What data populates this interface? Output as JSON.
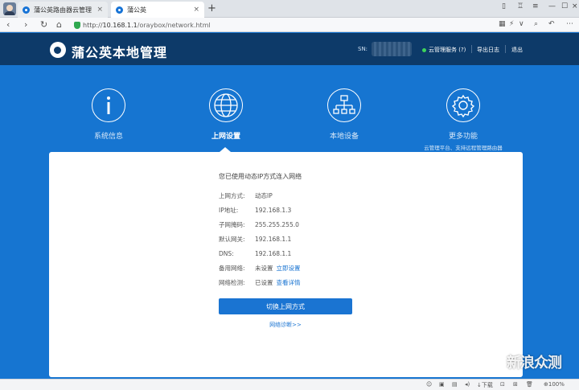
{
  "browser": {
    "tabs": [
      {
        "title": "蒲公英路由器云管理"
      },
      {
        "title": "蒲公英"
      }
    ],
    "new_tab": "+",
    "url_prefix": "http://",
    "url_host": "10.168.1.1",
    "url_path": "/oraybox/network.html",
    "zoom": "100%",
    "download_label": "下载"
  },
  "header": {
    "brand": "蒲公英本地管理",
    "sn_label": "SN:",
    "links": [
      "云管理服务 (?)",
      "导出日志",
      "退出"
    ]
  },
  "nav": [
    {
      "label": "系统信息",
      "icon": "info-icon"
    },
    {
      "label": "上网设置",
      "icon": "globe-icon",
      "active": true
    },
    {
      "label": "本地设备",
      "icon": "network-tree-icon"
    },
    {
      "label": "更多功能",
      "icon": "gear-icon",
      "sub": "云管理平台、支持远程管理路由器"
    }
  ],
  "panel": {
    "title": "您已使用动态IP方式连入网络",
    "rows": [
      {
        "key": "上网方式:",
        "value": "动态IP"
      },
      {
        "key": "IP地址:",
        "value": "192.168.1.3"
      },
      {
        "key": "子网掩码:",
        "value": "255.255.255.0"
      },
      {
        "key": "默认网关:",
        "value": "192.168.1.1"
      },
      {
        "key": "DNS:",
        "value": "192.168.1.1"
      },
      {
        "key": "备用网络:",
        "value": "未设置",
        "link": "立即设置"
      },
      {
        "key": "网络检测:",
        "value": "已设置",
        "link": "查看详情"
      }
    ],
    "button": "切换上网方式",
    "diag_link": "网络诊断>>"
  },
  "watermark": "新浪众测",
  "colors": {
    "header_bg": "#0d3a69",
    "page_bg": "#1675d1",
    "accent": "#1a74d2",
    "online": "#3ed35a"
  }
}
